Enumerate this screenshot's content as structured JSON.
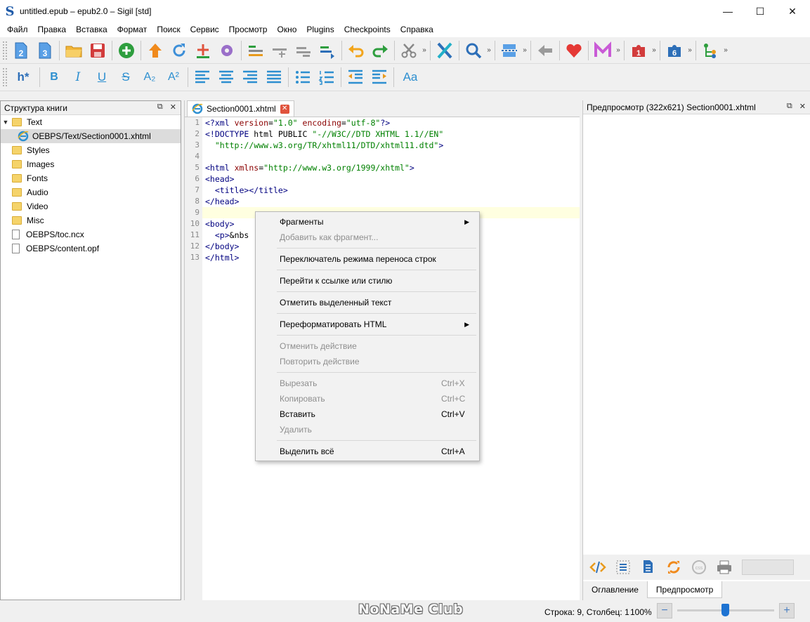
{
  "window": {
    "app_icon_glyph": "S",
    "title": "untitled.epub – epub2.0 – Sigil [std]",
    "minimize": "—",
    "maximize": "☐",
    "close": "✕"
  },
  "menubar": [
    "Файл",
    "Правка",
    "Вставка",
    "Формат",
    "Поиск",
    "Сервис",
    "Просмотр",
    "Окно",
    "Plugins",
    "Checkpoints",
    "Справка"
  ],
  "toolbar1": {
    "badge_2": "2",
    "badge_3": "3",
    "plugin_badge_1": "1",
    "plugin_badge_6": "6",
    "chevron": "»"
  },
  "toolbar2": {
    "heading": "h*",
    "bold": "B",
    "italic": "I",
    "underline": "U",
    "strike": "S",
    "subscript": "A₂",
    "superscript": "A²",
    "case": "Aa"
  },
  "book_browser": {
    "title": "Структура книги",
    "float_btn": "⧉",
    "close_btn": "✕",
    "items": [
      {
        "label": "Text",
        "type": "folder",
        "expanded": true
      },
      {
        "label": "OEBPS/Text/Section0001.xhtml",
        "type": "xhtml",
        "selected": true
      },
      {
        "label": "Styles",
        "type": "folder"
      },
      {
        "label": "Images",
        "type": "folder"
      },
      {
        "label": "Fonts",
        "type": "folder"
      },
      {
        "label": "Audio",
        "type": "folder"
      },
      {
        "label": "Video",
        "type": "folder"
      },
      {
        "label": "Misc",
        "type": "folder"
      },
      {
        "label": "OEBPS/toc.ncx",
        "type": "file"
      },
      {
        "label": "OEBPS/content.opf",
        "type": "file"
      }
    ]
  },
  "editor": {
    "tab_label": "Section0001.xhtml",
    "tab_close": "✕",
    "current_line": 9,
    "lines": [
      "<?xml version=\"1.0\" encoding=\"utf-8\"?>",
      "<!DOCTYPE html PUBLIC \"-//W3C//DTD XHTML 1.1//EN\"",
      "  \"http://www.w3.org/TR/xhtml11/DTD/xhtml11.dtd\">",
      "",
      "<html xmlns=\"http://www.w3.org/1999/xhtml\">",
      "<head>",
      "  <title></title>",
      "</head>",
      "",
      "<body>",
      "  <p>&nbs",
      "</body>",
      "</html>"
    ]
  },
  "context_menu": {
    "groups": [
      [
        {
          "label": "Фрагменты",
          "submenu": true
        },
        {
          "label": "Добавить как фрагмент...",
          "disabled": true
        }
      ],
      [
        {
          "label": "Переключатель режима переноса строк"
        }
      ],
      [
        {
          "label": "Перейти к ссылке или стилю"
        }
      ],
      [
        {
          "label": "Отметить выделенный текст"
        }
      ],
      [
        {
          "label": "Переформатировать HTML",
          "submenu": true
        }
      ],
      [
        {
          "label": "Отменить действие",
          "disabled": true
        },
        {
          "label": "Повторить действие",
          "disabled": true
        }
      ],
      [
        {
          "label": "Вырезать",
          "shortcut": "Ctrl+X",
          "disabled": true
        },
        {
          "label": "Копировать",
          "shortcut": "Ctrl+C",
          "disabled": true
        },
        {
          "label": "Вставить",
          "shortcut": "Ctrl+V"
        },
        {
          "label": "Удалить",
          "disabled": true
        }
      ],
      [
        {
          "label": "Выделить всё",
          "shortcut": "Ctrl+A"
        }
      ]
    ]
  },
  "preview": {
    "title": "Предпросмотр (322x621) Section0001.xhtml",
    "float_btn": "⧉",
    "close_btn": "✕",
    "tabs": [
      {
        "label": "Оглавление",
        "active": false
      },
      {
        "label": "Предпросмотр",
        "active": true
      }
    ]
  },
  "statusbar": {
    "watermark": "NoNaMe Club",
    "position": "Строка: 9, Столбец: 1",
    "zoom": "100%",
    "zoom_out": "−",
    "zoom_in": "+",
    "zoom_slider_fraction": 0.49
  },
  "colors": {
    "accent_blue": "#1e73d2",
    "current_line": "#ffffe0",
    "folder": "#f5d36a"
  }
}
